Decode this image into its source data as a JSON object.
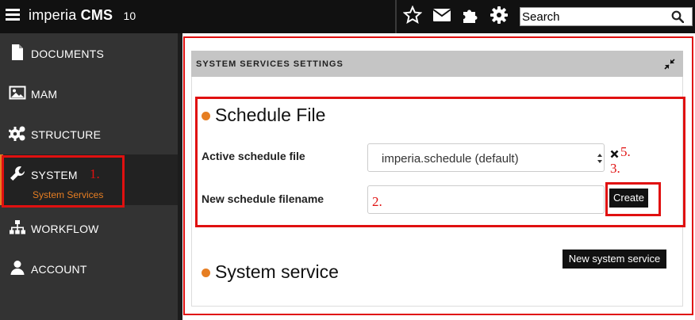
{
  "app": {
    "brand_light": "imperia",
    "brand_bold": "CMS",
    "version": "10"
  },
  "search": {
    "placeholder": "Search"
  },
  "sidebar": {
    "items": [
      {
        "label": "DOCUMENTS"
      },
      {
        "label": "MAM"
      },
      {
        "label": "STRUCTURE"
      },
      {
        "label": "SYSTEM",
        "subitem": "System Services"
      },
      {
        "label": "WORKFLOW"
      },
      {
        "label": "ACCOUNT"
      }
    ]
  },
  "panel": {
    "title": "SYSTEM SERVICES SETTINGS"
  },
  "schedule": {
    "title": "Schedule File",
    "active_label": "Active schedule file",
    "active_value": "imperia.schedule (default)",
    "new_label": "New schedule filename",
    "create_button": "Create"
  },
  "service": {
    "title": "System service",
    "new_button": "New system service"
  },
  "annotations": {
    "a1": "1.",
    "a2": "2.",
    "a3": "3.",
    "a5": "5."
  },
  "colors": {
    "accent": "#e67e22",
    "annotation": "#e01010",
    "sidebar": "#333333",
    "topbar": "#111111"
  }
}
